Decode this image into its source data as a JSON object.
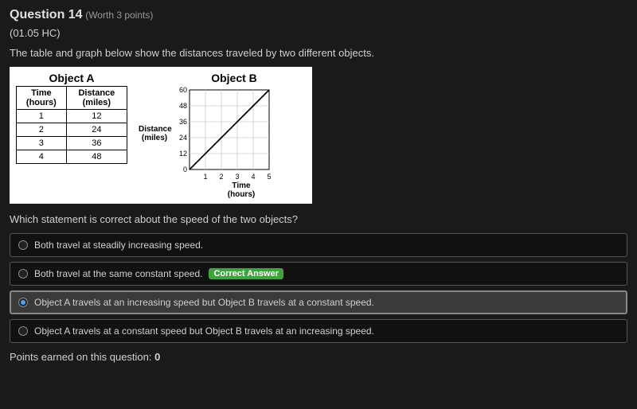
{
  "header": {
    "title": "Question 14",
    "worth": "(Worth 3 points)",
    "code": "(01.05 HC)"
  },
  "prompt": "The table and graph below show the distances traveled by two different objects.",
  "objectA": {
    "title": "Object A",
    "col1": "Time (hours)",
    "col2": "Distance (miles)",
    "rows": [
      {
        "t": "1",
        "d": "12"
      },
      {
        "t": "2",
        "d": "24"
      },
      {
        "t": "3",
        "d": "36"
      },
      {
        "t": "4",
        "d": "48"
      }
    ]
  },
  "objectB": {
    "title": "Object B",
    "ylabel_l1": "Distance",
    "ylabel_l2": "(miles)",
    "xlabel_l1": "Time",
    "xlabel_l2": "(hours)"
  },
  "chart_data": {
    "type": "line",
    "title": "Object B",
    "xlabel": "Time (hours)",
    "ylabel": "Distance (miles)",
    "x": [
      0,
      1,
      2,
      3,
      4,
      5
    ],
    "y": [
      0,
      12,
      24,
      36,
      48,
      60
    ],
    "xlim": [
      0,
      5
    ],
    "ylim": [
      0,
      60
    ],
    "xticks": [
      1,
      2,
      3,
      4,
      5
    ],
    "yticks": [
      0,
      12,
      24,
      36,
      48,
      60
    ]
  },
  "question2": "Which statement is correct about the speed of the two objects?",
  "options": [
    {
      "text": "Both travel at steadily increasing speed.",
      "correct": false,
      "selected": false
    },
    {
      "text": "Both travel at the same constant speed.",
      "correct": true,
      "selected": false
    },
    {
      "text": "Object A travels at an increasing speed but Object B travels at a constant speed.",
      "correct": false,
      "selected": true
    },
    {
      "text": "Object A travels at a constant speed but Object B travels at an increasing speed.",
      "correct": false,
      "selected": false
    }
  ],
  "badge": "Correct Answer",
  "points": {
    "label": "Points earned on this question:",
    "value": "0"
  },
  "yt": {
    "0": "0",
    "1": "12",
    "2": "24",
    "3": "36",
    "4": "48",
    "5": "60"
  },
  "xt": {
    "1": "1",
    "2": "2",
    "3": "3",
    "4": "4",
    "5": "5"
  }
}
